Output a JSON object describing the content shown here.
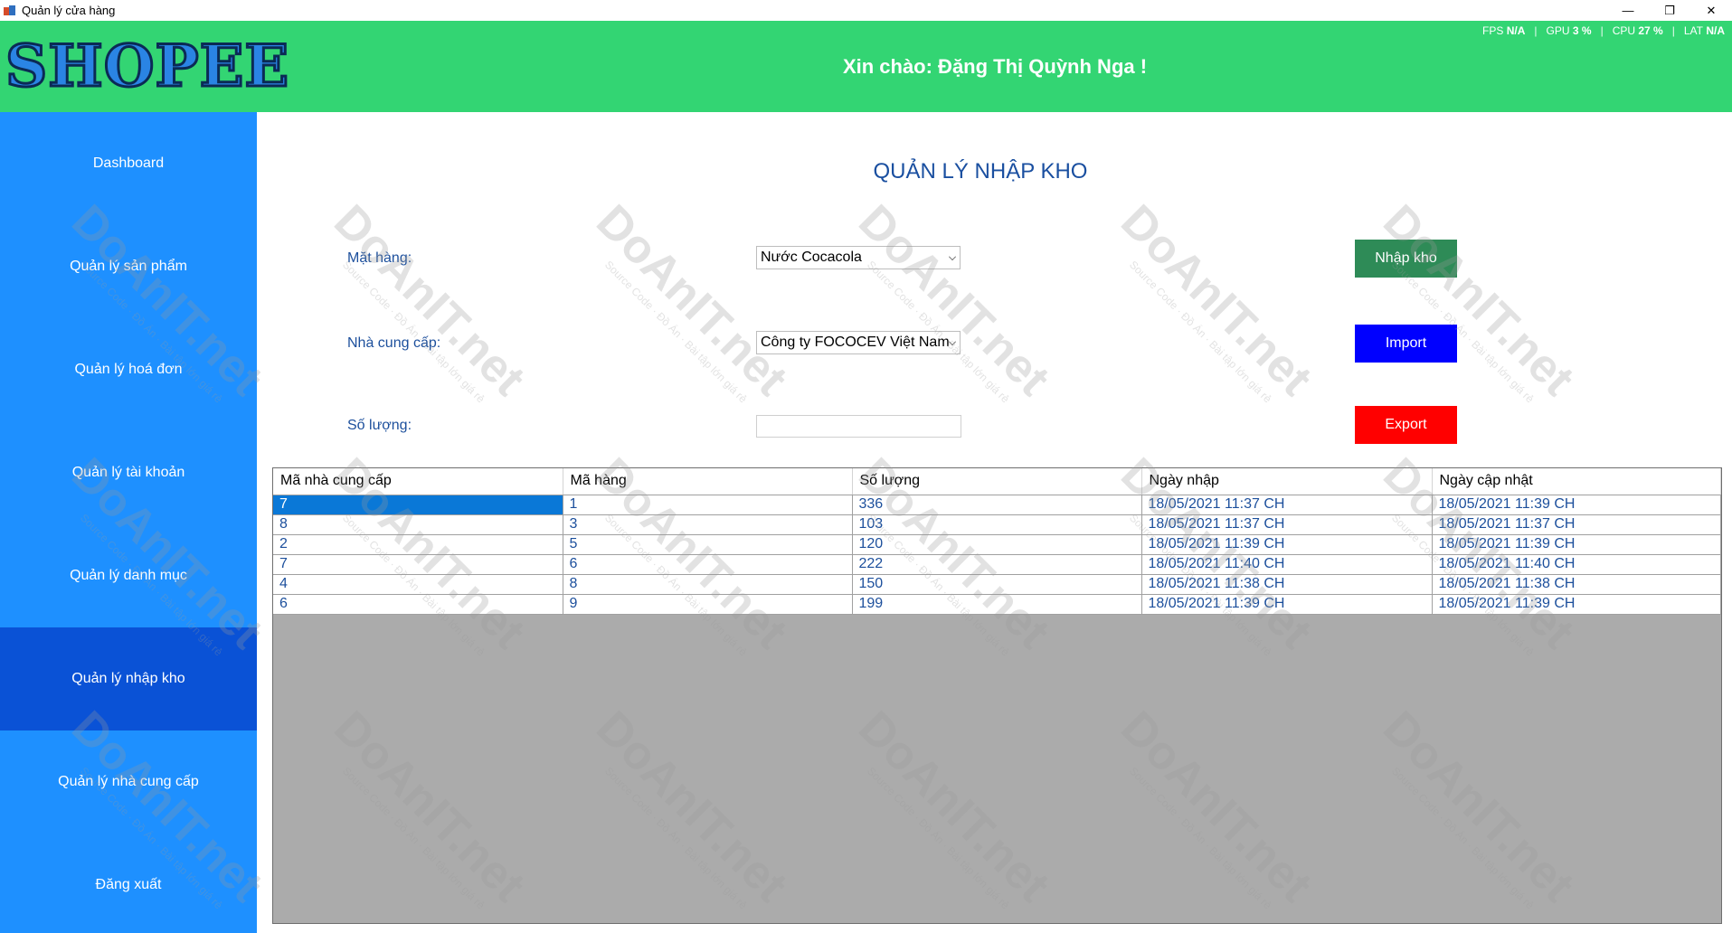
{
  "window": {
    "title": "Quản lý cửa hàng",
    "controls": {
      "minimize": "—",
      "maximize": "❐",
      "close": "✕"
    }
  },
  "perf": {
    "fps_label": "FPS",
    "fps_value": "N/A",
    "gpu_label": "GPU",
    "gpu_value": "3 %",
    "cpu_label": "CPU",
    "cpu_value": "27 %",
    "lat_label": "LAT",
    "lat_value": "N/A"
  },
  "header": {
    "logo": "SHOPEE",
    "greeting": "Xin chào: Đặng Thị Quỳnh Nga !"
  },
  "sidebar": {
    "items": [
      {
        "label": "Dashboard"
      },
      {
        "label": "Quản lý sản phẩm"
      },
      {
        "label": "Quản lý hoá đơn"
      },
      {
        "label": "Quản lý tài khoản"
      },
      {
        "label": "Quản lý danh mục"
      },
      {
        "label": "Quản lý nhập kho"
      },
      {
        "label": "Quản lý nhà cung cấp"
      },
      {
        "label": "Đăng xuất"
      }
    ],
    "active_index": 5
  },
  "main": {
    "title": "QUẢN LÝ NHẬP KHO",
    "form": {
      "product_label": "Mặt hàng:",
      "product_value": "Nước Cocacola",
      "supplier_label": "Nhà cung cấp:",
      "supplier_value": "Công ty FOCOCEV Việt Nam",
      "quantity_label": "Số lượng:",
      "quantity_value": ""
    },
    "buttons": {
      "import_stock": "Nhập kho",
      "import": "Import",
      "export": "Export"
    },
    "grid": {
      "columns": [
        "Mã nhà cung cấp",
        "Mã hàng",
        "Số lượng",
        "Ngày nhập",
        "Ngày cập nhật"
      ],
      "rows": [
        [
          "7",
          "1",
          "336",
          "18/05/2021 11:37 CH",
          "18/05/2021 11:39 CH"
        ],
        [
          "8",
          "3",
          "103",
          "18/05/2021 11:37 CH",
          "18/05/2021 11:37 CH"
        ],
        [
          "2",
          "5",
          "120",
          "18/05/2021 11:39 CH",
          "18/05/2021 11:39 CH"
        ],
        [
          "7",
          "6",
          "222",
          "18/05/2021 11:40 CH",
          "18/05/2021 11:40 CH"
        ],
        [
          "4",
          "8",
          "150",
          "18/05/2021 11:38 CH",
          "18/05/2021 11:38 CH"
        ],
        [
          "6",
          "9",
          "199",
          "18/05/2021 11:39 CH",
          "18/05/2021 11:39 CH"
        ]
      ]
    }
  },
  "watermark": {
    "text": "DoAnIT.net",
    "subtext": "Source Code · Đồ Án · Bài tập lớn giá rẻ"
  },
  "colors": {
    "header": "#33d573",
    "sidebar": "#1e90ff",
    "sidebar_active": "#0a52d6",
    "btn_import_stock": "#2e8b57",
    "btn_import": "#0000ff",
    "btn_export": "#ff0000",
    "selection": "#0a78d7"
  }
}
